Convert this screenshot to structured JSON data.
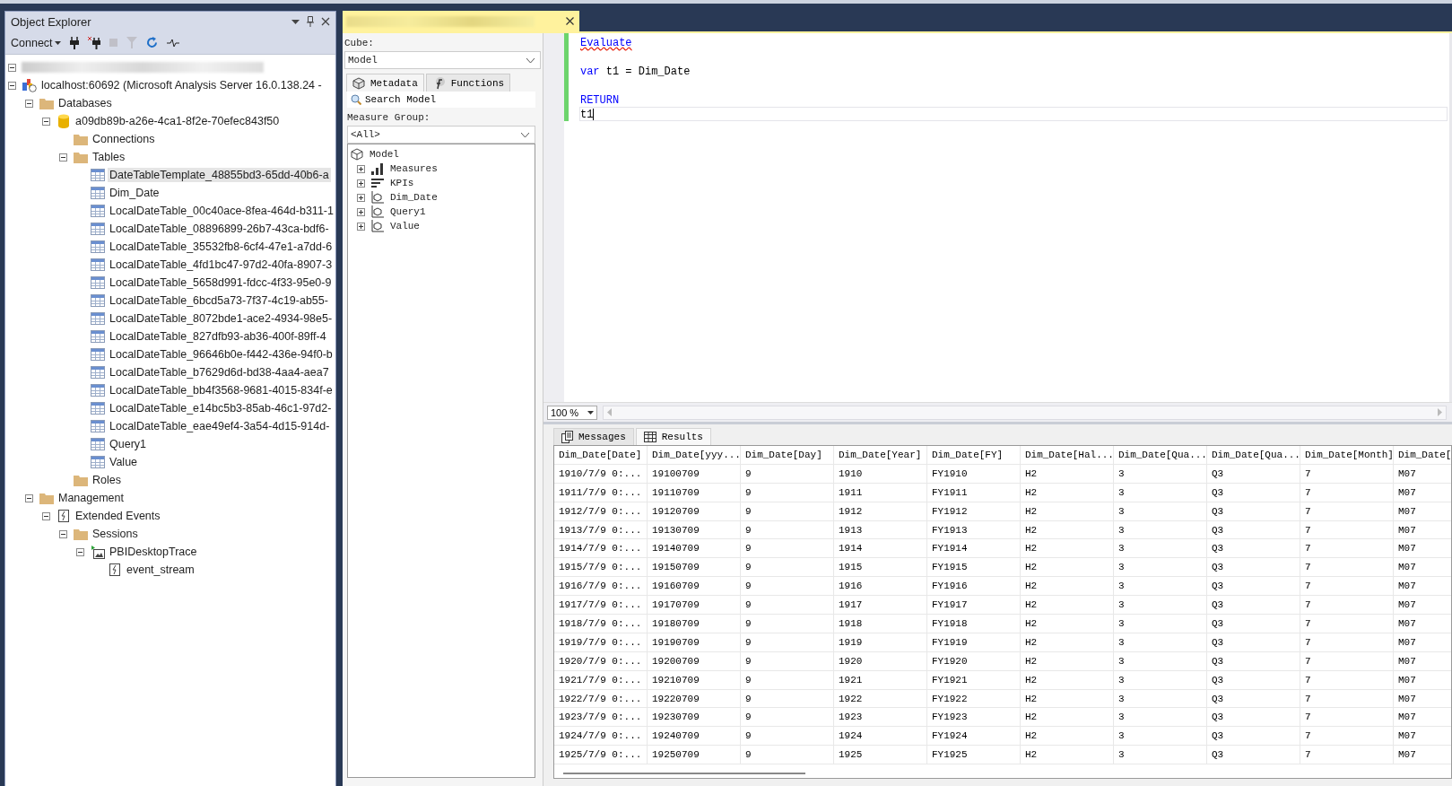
{
  "object_explorer": {
    "title": "Object Explorer",
    "connect": "Connect",
    "tree": [
      {
        "kind": "blurred",
        "expanded": true
      },
      {
        "label": "localhost:60692 (Microsoft Analysis Server 16.0.138.24 -",
        "kind": "server",
        "expanded": true,
        "selected": false,
        "children": [
          {
            "label": "Databases",
            "kind": "folder",
            "expanded": true,
            "selected": false,
            "children": [
              {
                "label": "a09db89b-a26e-4ca1-8f2e-70efec843f50",
                "kind": "database",
                "expanded": true,
                "selected": false,
                "children": [
                  {
                    "label": "Connections",
                    "kind": "folder",
                    "selected": false
                  },
                  {
                    "label": "Tables",
                    "kind": "folder",
                    "expanded": true,
                    "selected": false,
                    "children": [
                      {
                        "label": "DateTableTemplate_48855bd3-65dd-40b6-a",
                        "kind": "table",
                        "selected": true
                      },
                      {
                        "label": "Dim_Date",
                        "kind": "table",
                        "selected": false
                      },
                      {
                        "label": "LocalDateTable_00c40ace-8fea-464d-b311-1",
                        "kind": "table",
                        "selected": false
                      },
                      {
                        "label": "LocalDateTable_08896899-26b7-43ca-bdf6-",
                        "kind": "table",
                        "selected": false
                      },
                      {
                        "label": "LocalDateTable_35532fb8-6cf4-47e1-a7dd-6",
                        "kind": "table",
                        "selected": false
                      },
                      {
                        "label": "LocalDateTable_4fd1bc47-97d2-40fa-8907-3",
                        "kind": "table",
                        "selected": false
                      },
                      {
                        "label": "LocalDateTable_5658d991-fdcc-4f33-95e0-9",
                        "kind": "table",
                        "selected": false
                      },
                      {
                        "label": "LocalDateTable_6bcd5a73-7f37-4c19-ab55-",
                        "kind": "table",
                        "selected": false
                      },
                      {
                        "label": "LocalDateTable_8072bde1-ace2-4934-98e5-",
                        "kind": "table",
                        "selected": false
                      },
                      {
                        "label": "LocalDateTable_827dfb93-ab36-400f-89ff-4",
                        "kind": "table",
                        "selected": false
                      },
                      {
                        "label": "LocalDateTable_96646b0e-f442-436e-94f0-b",
                        "kind": "table",
                        "selected": false
                      },
                      {
                        "label": "LocalDateTable_b7629d6d-bd38-4aa4-aea7",
                        "kind": "table",
                        "selected": false
                      },
                      {
                        "label": "LocalDateTable_bb4f3568-9681-4015-834f-e",
                        "kind": "table",
                        "selected": false
                      },
                      {
                        "label": "LocalDateTable_e14bc5b3-85ab-46c1-97d2-",
                        "kind": "table",
                        "selected": false
                      },
                      {
                        "label": "LocalDateTable_eae49ef4-3a54-4d15-914d-",
                        "kind": "table",
                        "selected": false
                      },
                      {
                        "label": "Query1",
                        "kind": "table",
                        "selected": false
                      },
                      {
                        "label": "Value",
                        "kind": "table",
                        "selected": false
                      }
                    ]
                  },
                  {
                    "label": "Roles",
                    "kind": "folder",
                    "selected": false
                  }
                ]
              }
            ]
          },
          {
            "label": "Management",
            "kind": "folder",
            "expanded": true,
            "selected": false,
            "children": [
              {
                "label": "Extended Events",
                "kind": "xevents",
                "expanded": true,
                "selected": false,
                "children": [
                  {
                    "label": "Sessions",
                    "kind": "folder",
                    "expanded": true,
                    "selected": false,
                    "children": [
                      {
                        "label": "PBIDesktopTrace",
                        "kind": "session",
                        "expanded": true,
                        "selected": false,
                        "children": [
                          {
                            "label": "event_stream",
                            "kind": "xevents",
                            "selected": false
                          }
                        ]
                      }
                    ]
                  }
                ]
              }
            ]
          }
        ]
      }
    ]
  },
  "metadata_panel": {
    "cube_label": "Cube:",
    "cube": "Model",
    "tabs": [
      {
        "label": "Metadata",
        "kind": "metadata",
        "selected": true
      },
      {
        "label": "Functions",
        "kind": "functions",
        "selected": false
      }
    ],
    "search": "Search Model",
    "measure_group_label": "Measure Group:",
    "measure_group": "<All>",
    "tree": {
      "label": "Model",
      "children": [
        {
          "label": "Measures",
          "kind": "measures",
          "expanded": false
        },
        {
          "label": "KPIs",
          "kind": "kpis",
          "expanded": false
        },
        {
          "label": "Dim_Date",
          "kind": "dimension",
          "expanded": false
        },
        {
          "label": "Query1",
          "kind": "dimension",
          "expanded": false
        },
        {
          "label": "Value",
          "kind": "dimension",
          "expanded": false
        }
      ]
    }
  },
  "editor": {
    "lines": [
      {
        "kind": "code",
        "tokens": [
          {
            "text": "Evaluate",
            "kind": "error"
          }
        ],
        "current": false
      },
      {
        "kind": "blank",
        "current": false
      },
      {
        "kind": "code",
        "tokens": [
          {
            "text": "var",
            "kind": "keyword"
          },
          {
            "text": " t1 = Dim_Date",
            "kind": "plain"
          }
        ],
        "current": false
      },
      {
        "kind": "blank",
        "current": false
      },
      {
        "kind": "code",
        "tokens": [
          {
            "text": "RETURN",
            "kind": "keyword"
          }
        ],
        "current": false
      },
      {
        "kind": "code",
        "tokens": [
          {
            "text": "t1",
            "kind": "plain"
          }
        ],
        "current": true
      }
    ]
  },
  "zoom": "100 %",
  "results": {
    "tabs": [
      {
        "label": "Messages",
        "kind": "messages",
        "selected": false
      },
      {
        "label": "Results",
        "kind": "grid",
        "selected": true
      }
    ],
    "columns": [
      "Dim_Date[Date]",
      "Dim_Date[yyy...",
      "Dim_Date[Day]",
      "Dim_Date[Year]",
      "Dim_Date[FY]",
      "Dim_Date[Hal...",
      "Dim_Date[Qua...",
      "Dim_Date[Qua...",
      "Dim_Date[Month]",
      "Dim_Date["
    ],
    "rows": [
      [
        "1910/7/9 0:...",
        "19100709",
        "9",
        "1910",
        "FY1910",
        "H2",
        "3",
        "Q3",
        "7",
        "M07"
      ],
      [
        "1911/7/9 0:...",
        "19110709",
        "9",
        "1911",
        "FY1911",
        "H2",
        "3",
        "Q3",
        "7",
        "M07"
      ],
      [
        "1912/7/9 0:...",
        "19120709",
        "9",
        "1912",
        "FY1912",
        "H2",
        "3",
        "Q3",
        "7",
        "M07"
      ],
      [
        "1913/7/9 0:...",
        "19130709",
        "9",
        "1913",
        "FY1913",
        "H2",
        "3",
        "Q3",
        "7",
        "M07"
      ],
      [
        "1914/7/9 0:...",
        "19140709",
        "9",
        "1914",
        "FY1914",
        "H2",
        "3",
        "Q3",
        "7",
        "M07"
      ],
      [
        "1915/7/9 0:...",
        "19150709",
        "9",
        "1915",
        "FY1915",
        "H2",
        "3",
        "Q3",
        "7",
        "M07"
      ],
      [
        "1916/7/9 0:...",
        "19160709",
        "9",
        "1916",
        "FY1916",
        "H2",
        "3",
        "Q3",
        "7",
        "M07"
      ],
      [
        "1917/7/9 0:...",
        "19170709",
        "9",
        "1917",
        "FY1917",
        "H2",
        "3",
        "Q3",
        "7",
        "M07"
      ],
      [
        "1918/7/9 0:...",
        "19180709",
        "9",
        "1918",
        "FY1918",
        "H2",
        "3",
        "Q3",
        "7",
        "M07"
      ],
      [
        "1919/7/9 0:...",
        "19190709",
        "9",
        "1919",
        "FY1919",
        "H2",
        "3",
        "Q3",
        "7",
        "M07"
      ],
      [
        "1920/7/9 0:...",
        "19200709",
        "9",
        "1920",
        "FY1920",
        "H2",
        "3",
        "Q3",
        "7",
        "M07"
      ],
      [
        "1921/7/9 0:...",
        "19210709",
        "9",
        "1921",
        "FY1921",
        "H2",
        "3",
        "Q3",
        "7",
        "M07"
      ],
      [
        "1922/7/9 0:...",
        "19220709",
        "9",
        "1922",
        "FY1922",
        "H2",
        "3",
        "Q3",
        "7",
        "M07"
      ],
      [
        "1923/7/9 0:...",
        "19230709",
        "9",
        "1923",
        "FY1923",
        "H2",
        "3",
        "Q3",
        "7",
        "M07"
      ],
      [
        "1924/7/9 0:...",
        "19240709",
        "9",
        "1924",
        "FY1924",
        "H2",
        "3",
        "Q3",
        "7",
        "M07"
      ],
      [
        "1925/7/9 0:...",
        "19250709",
        "9",
        "1925",
        "FY1925",
        "H2",
        "3",
        "Q3",
        "7",
        "M07"
      ]
    ]
  }
}
